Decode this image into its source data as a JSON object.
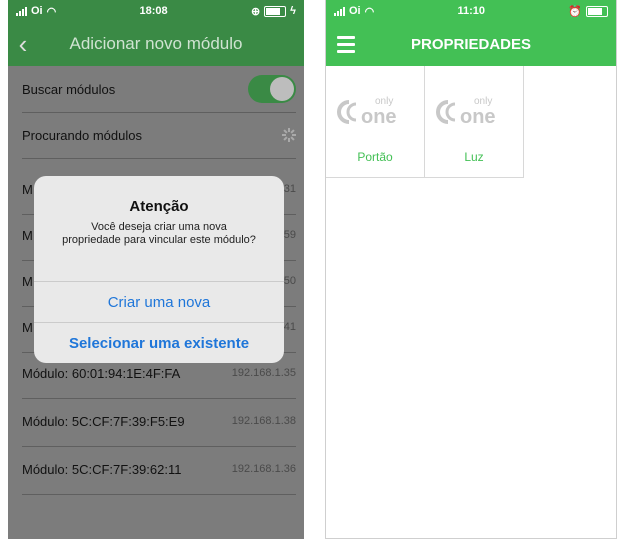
{
  "left_screen": {
    "status": {
      "carrier": "Oi",
      "time": "18:08"
    },
    "nav": {
      "back_icon": "chevron-left-icon",
      "title": "Adicionar novo módulo"
    },
    "search_toggle": {
      "label": "Buscar módulos",
      "on": true
    },
    "searching": {
      "label": "Procurando módulos"
    },
    "modules": [
      {
        "label": "M",
        "ip": "31"
      },
      {
        "label": "M",
        "ip": "59"
      },
      {
        "label": "M",
        "ip": "50"
      },
      {
        "label": "M",
        "ip": "41"
      },
      {
        "label": "Módulo: 60:01:94:1E:4F:FA",
        "ip": "192.168.1.35"
      },
      {
        "label": "Módulo: 5C:CF:7F:39:F5:E9",
        "ip": "192.168.1.38"
      },
      {
        "label": "Módulo: 5C:CF:7F:39:62:11",
        "ip": "192.168.1.36"
      }
    ],
    "dialog": {
      "title": "Atenção",
      "message": "Você deseja criar uma nova propriedade para vincular este módulo?",
      "create_label": "Criar uma nova",
      "select_label": "Selecionar uma existente"
    }
  },
  "right_screen": {
    "status": {
      "carrier": "Oi",
      "time": "11:10"
    },
    "nav": {
      "menu_icon": "hamburger-menu-icon",
      "title": "PROPRIEDADES"
    },
    "properties": [
      {
        "logo_top": "only",
        "logo_main": "one",
        "label": "Portão"
      },
      {
        "logo_top": "only",
        "logo_main": "one",
        "label": "Luz"
      }
    ]
  },
  "colors": {
    "green_dark": "#3a8a45",
    "green": "#43c055",
    "ios_blue": "#1f76d9"
  }
}
